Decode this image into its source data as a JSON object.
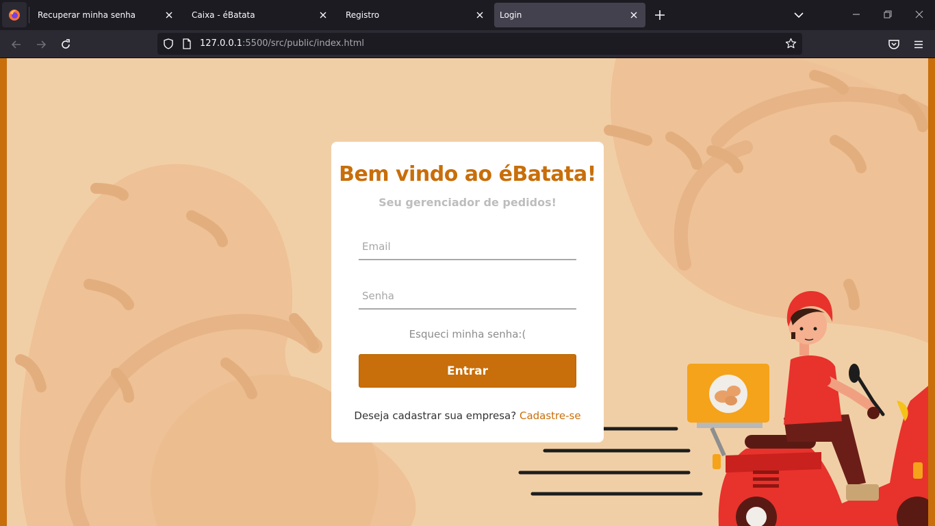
{
  "browser": {
    "tabs": [
      {
        "label": "Recuperar minha senha",
        "active": false
      },
      {
        "label": "Caixa - éBatata",
        "active": false
      },
      {
        "label": "Registro",
        "active": false
      },
      {
        "label": "Login",
        "active": true
      }
    ],
    "url": {
      "host": "127.0.0.1",
      "rest": ":5500/src/public/index.html"
    }
  },
  "login": {
    "title": "Bem vindo ao éBatata!",
    "subtitle": "Seu gerenciador de pedidos!",
    "email_placeholder": "Email",
    "password_placeholder": "Senha",
    "forgot_label": "Esqueci minha senha:(",
    "submit_label": "Entrar",
    "signup_question": "Deseja cadastrar sua empresa?",
    "signup_link": "Cadastre-se"
  },
  "colors": {
    "accent": "#c86e0a",
    "background": "#f1cfa6",
    "scooter": "#e8322c"
  }
}
